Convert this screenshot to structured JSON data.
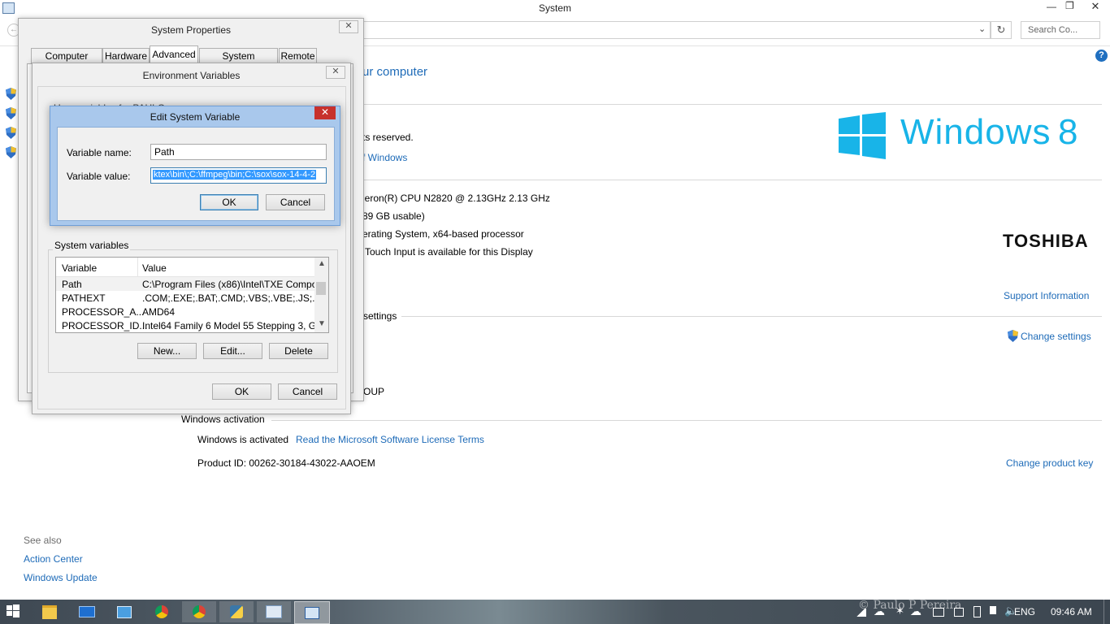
{
  "window": {
    "title": "System",
    "search_placeholder": "Search Co...",
    "help_label": "?"
  },
  "system_page": {
    "heading_fragment": "ur computer",
    "rights_fragment": "ts reserved.",
    "windows_link_fragment": "f Windows",
    "processor_fragment": "leron(R) CPU  N2820  @ 2.13GHz   2.13 GHz",
    "ram_fragment": "89 GB usable)",
    "system_type_fragment": "erating System, x64-based processor",
    "pen_touch_fragment": "Touch Input is available for this Display",
    "support_info": "Support Information",
    "settings_section_fragment": "settings",
    "change_settings": "Change settings",
    "workgroup_fragment": "OUP",
    "activation_section": "Windows activation",
    "activation_status": "Windows is activated",
    "license_link": "Read the Microsoft Software License Terms",
    "product_id": "Product ID:  00262-30184-43022-AAOEM",
    "change_product_key": "Change product key",
    "windows_logo_text": "Windows",
    "windows_logo_version": "8",
    "oem_logo": "TOSHIBA"
  },
  "see_also": {
    "title": "See also",
    "items": [
      "Action Center",
      "Windows Update"
    ]
  },
  "system_properties": {
    "title": "System Properties",
    "close": "✕",
    "tabs": [
      "Computer Name",
      "Hardware",
      "Advanced",
      "System Protection",
      "Remote"
    ],
    "active_tab": "Advanced"
  },
  "env_vars": {
    "title": "Environment Variables",
    "close": "✕",
    "user_vars_fragment": "User variables for PAULO",
    "system_vars_label": "System variables",
    "columns": [
      "Variable",
      "Value"
    ],
    "rows": [
      {
        "name": "Path",
        "value": "C:\\Program Files (x86)\\Intel\\TXE Compo..."
      },
      {
        "name": "PATHEXT",
        "value": ".COM;.EXE;.BAT;.CMD;.VBS;.VBE;.JS;...."
      },
      {
        "name": "PROCESSOR_A...",
        "value": "AMD64"
      },
      {
        "name": "PROCESSOR_ID...",
        "value": "Intel64 Family 6 Model 55 Stepping 3, G..."
      }
    ],
    "new_button": "New...",
    "edit_button": "Edit...",
    "delete_button": "Delete",
    "ok_button": "OK",
    "cancel_button": "Cancel"
  },
  "edit_var": {
    "title": "Edit System Variable",
    "close": "✕",
    "name_label": "Variable name:",
    "name_value": "Path",
    "value_label": "Variable value:",
    "value_value": "ktex\\bin\\;C:\\ffmpeg\\bin;C:\\sox\\sox-14-4-2",
    "ok_button": "OK",
    "cancel_button": "Cancel"
  },
  "taskbar": {
    "language": "ENG",
    "time": "09:46 AM",
    "watermark": "©  Paulo P Pereira"
  },
  "colors": {
    "link": "#1e6bb8",
    "win8_logo": "#18b4e8",
    "dialog_title_active": "#a9c8ec",
    "close_red": "#c7312c",
    "taskbar": "#3f4a55"
  }
}
